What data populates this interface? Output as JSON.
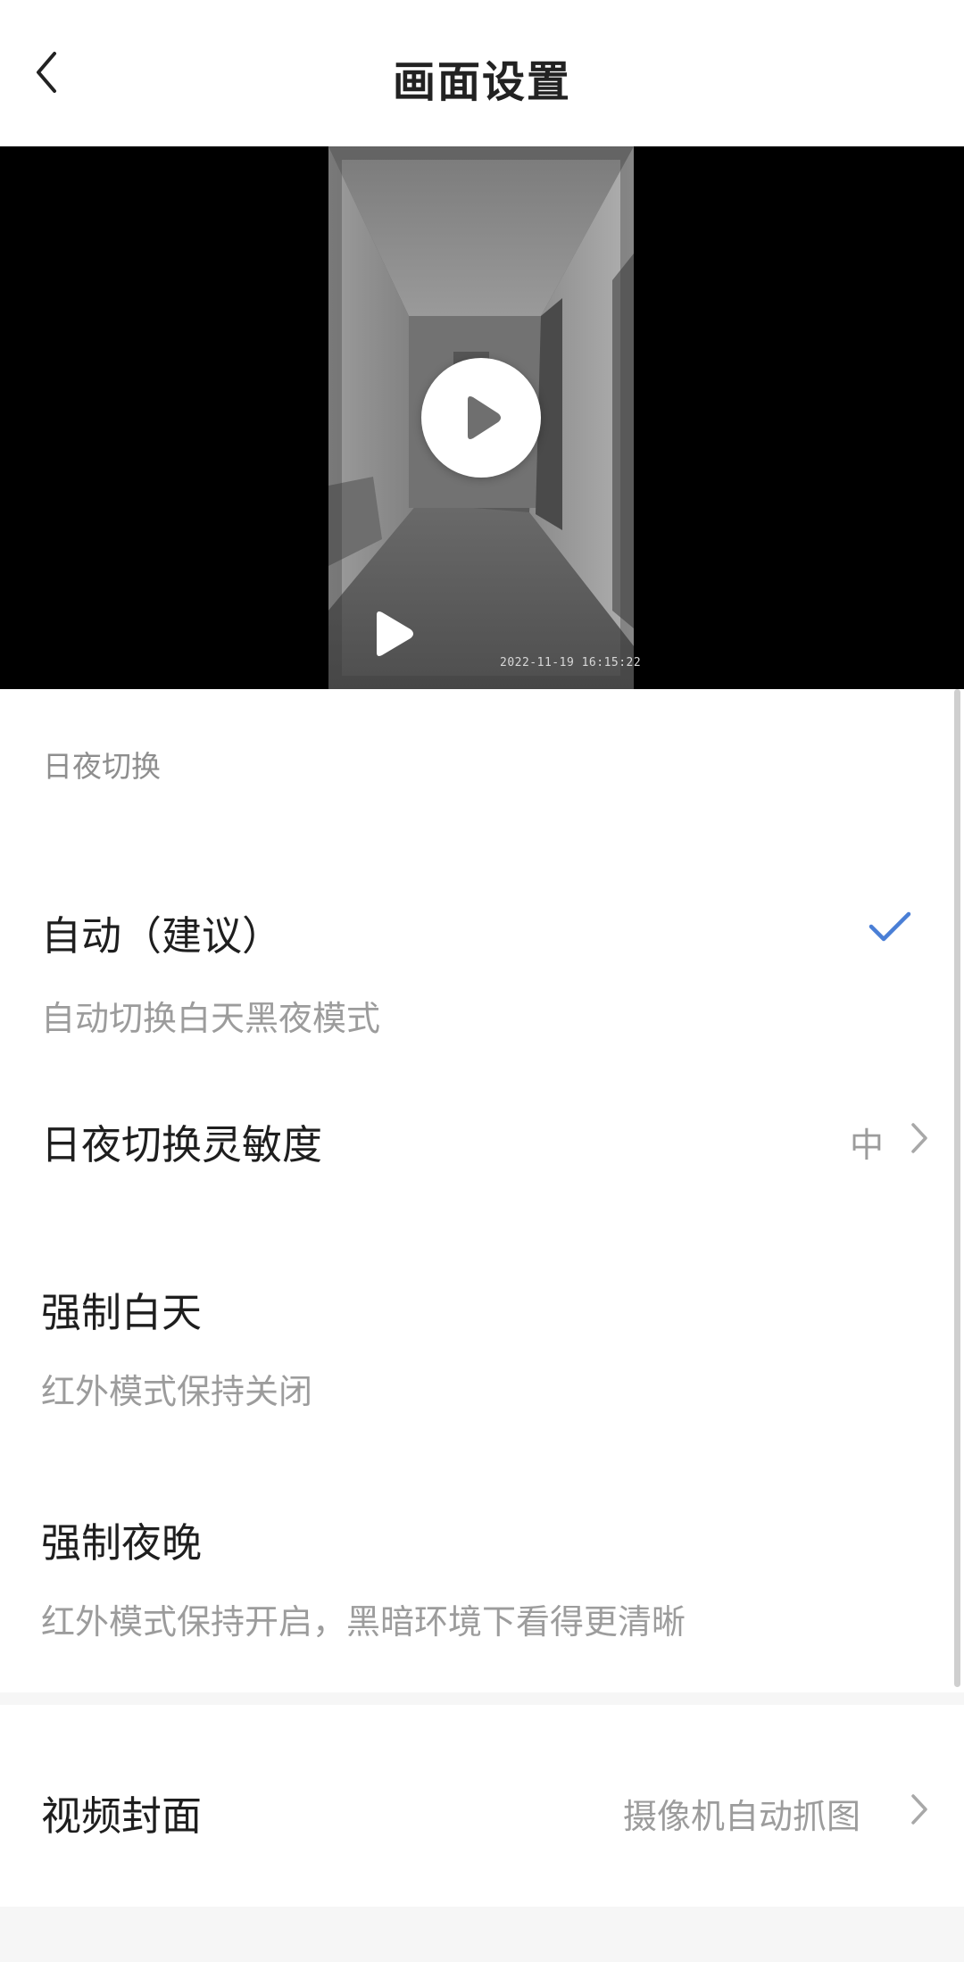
{
  "header": {
    "title": "画面设置"
  },
  "video": {
    "timestamp": "2022-11-19 16:15:22"
  },
  "day_night": {
    "section_label": "日夜切换",
    "auto": {
      "title": "自动（建议）",
      "desc": "自动切换白天黑夜模式",
      "selected": true
    },
    "sensitivity": {
      "title": "日夜切换灵敏度",
      "value": "中"
    },
    "force_day": {
      "title": "强制白天",
      "desc": "红外模式保持关闭"
    },
    "force_night": {
      "title": "强制夜晚",
      "desc": "红外模式保持开启，黑暗环境下看得更清晰"
    }
  },
  "video_cover": {
    "title": "视频封面",
    "value": "摄像机自动抓图"
  },
  "colors": {
    "accent": "#4a7fd6",
    "secondary_text": "#9c9c9c",
    "primary_text": "#1e1e1e"
  }
}
